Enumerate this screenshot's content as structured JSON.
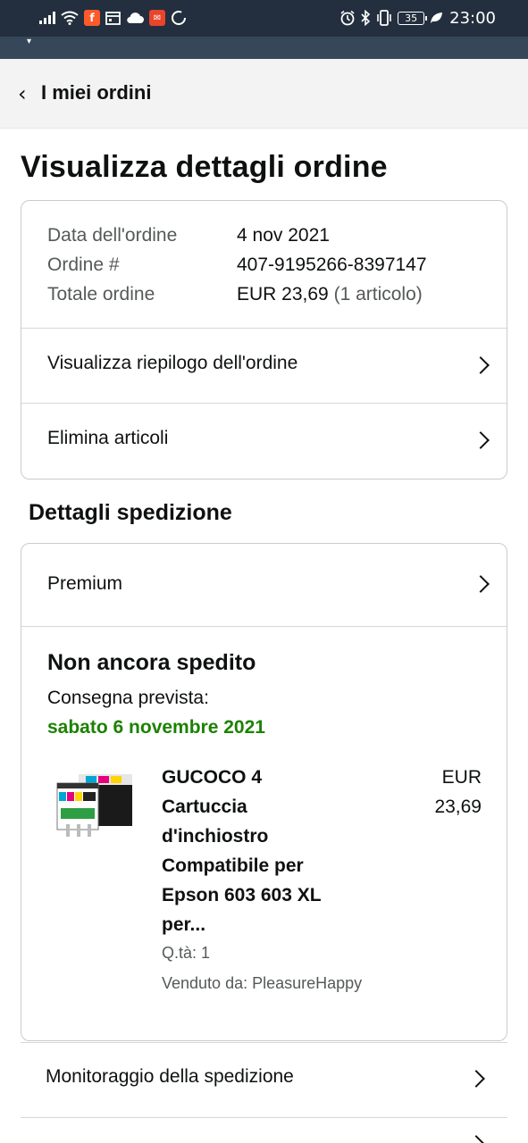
{
  "status_bar": {
    "time": "23:00",
    "battery": "35",
    "left_icons": [
      "signal-icon",
      "wifi-icon",
      "app-f-icon",
      "calendar-icon",
      "cloud-icon",
      "mail-icon",
      "circle-icon"
    ],
    "right_icons": [
      "alarm-icon",
      "bluetooth-icon",
      "vibrate-icon",
      "battery-icon",
      "leaf-icon"
    ]
  },
  "subnav": {
    "back_label": "I miei ordini"
  },
  "page": {
    "title": "Visualizza dettagli ordine"
  },
  "order": {
    "date_label": "Data dell'ordine",
    "date_value": "4 nov 2021",
    "number_label": "Ordine #",
    "number_value": "407-9195266-8397147",
    "total_label": "Totale ordine",
    "total_value": "EUR 23,69",
    "total_count": "(1 articolo)",
    "links": [
      {
        "label": "Visualizza riepilogo dell'ordine"
      },
      {
        "label": "Elimina articoli"
      }
    ]
  },
  "shipment": {
    "section_title": "Dettagli spedizione",
    "speed": "Premium",
    "status": "Non ancora spedito",
    "delivery_label": "Consegna prevista:",
    "delivery_date": "sabato 6 novembre 2021",
    "item": {
      "title_lines": [
        "GUCOCO 4",
        "Cartuccia",
        "d'inchiostro",
        "Compatibile per",
        "Epson 603 603 XL",
        "per..."
      ],
      "price_currency": "EUR",
      "price_value": "23,69",
      "quantity": "Q.tà: 1",
      "seller": "Venduto da: PleasureHappy"
    },
    "track_label": "Monitoraggio della spedizione"
  },
  "colors": {
    "header_dark": "#232f3e",
    "header_mid": "#37475a",
    "delivery_green": "#1d8102",
    "muted_text": "#565959"
  }
}
